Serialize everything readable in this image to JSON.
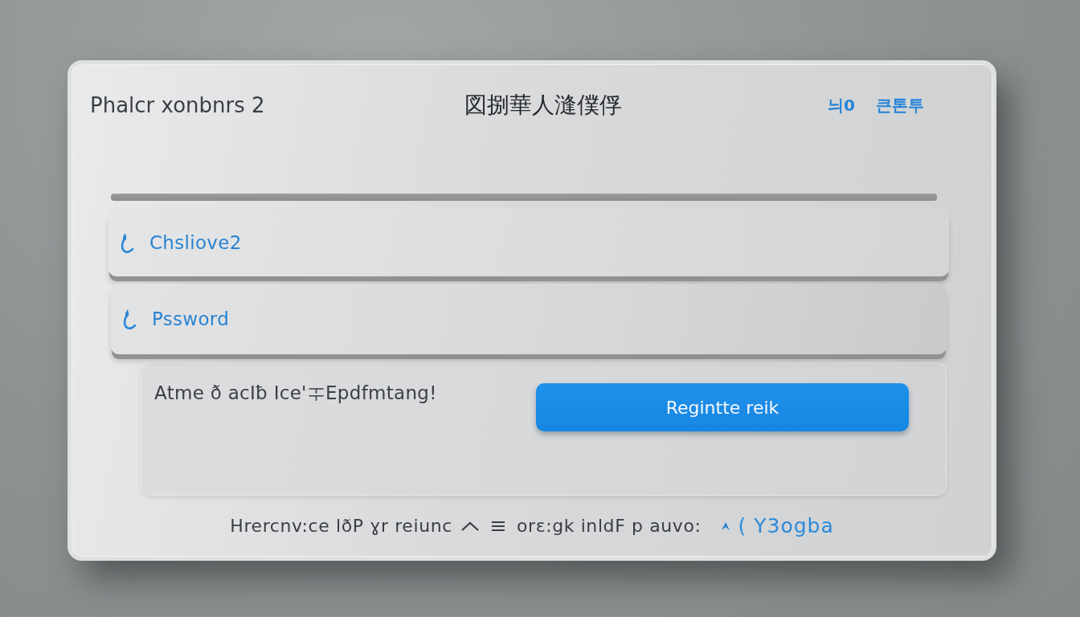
{
  "header": {
    "brand": "Phalcr xonbnrs 2",
    "title": "図捌華人漨僕俘",
    "links": [
      {
        "label": "늬0"
      },
      {
        "label": "큰톤투"
      }
    ]
  },
  "fields": [
    {
      "value": "Chsliove2"
    },
    {
      "placeholder": "Pssword"
    }
  ],
  "panel": {
    "text": "Atme ð acIƀ Ice'ᆍEpdfmtang!",
    "button": "Regintte reik"
  },
  "footer": {
    "text_1": "Hrercnv:ce  lðP ɣr reiunc",
    "text_2": "orɛ:gk  inldF  p auvo:",
    "link": "( Y3ogba"
  }
}
